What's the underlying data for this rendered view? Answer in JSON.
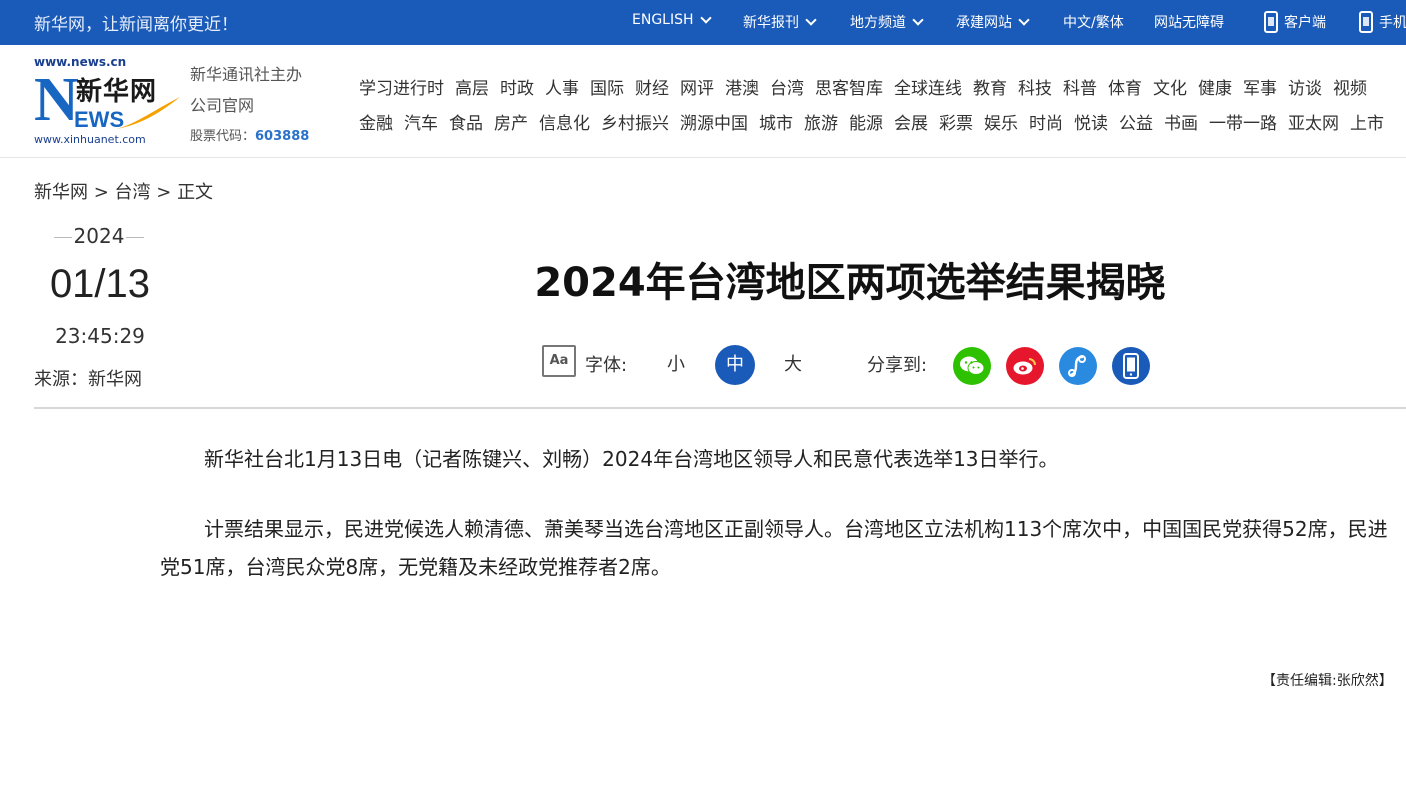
{
  "topbar": {
    "slogan": "新华网，让新闻离你更近！",
    "items": {
      "english": "ENGLISH",
      "newspapers": "新华报刊",
      "local": "地方频道",
      "hosted": "承建网站",
      "lang": "中文/繁体",
      "accessible": "网站无障碍",
      "client": "客户端",
      "mobile": "手机"
    }
  },
  "logo": {
    "url_top": "www.news.cn",
    "brand_cn": "新华网",
    "brand_en": "EWS",
    "letter_n": "N",
    "url_bottom": "www.xinhuanet.com"
  },
  "sponsor": {
    "line1": "新华通讯社主办",
    "line2": "公司官网",
    "stock_label": "股票代码：",
    "stock_code": "603888"
  },
  "nav": {
    "row1": [
      "学习进行时",
      "高层",
      "时政",
      "人事",
      "国际",
      "财经",
      "网评",
      "港澳",
      "台湾",
      "思客智库",
      "全球连线",
      "教育",
      "科技",
      "科普",
      "体育",
      "文化",
      "健康",
      "军事",
      "访谈",
      "视频"
    ],
    "row2": [
      "金融",
      "汽车",
      "食品",
      "房产",
      "信息化",
      "乡村振兴",
      "溯源中国",
      "城市",
      "旅游",
      "能源",
      "会展",
      "彩票",
      "娱乐",
      "时尚",
      "悦读",
      "公益",
      "书画",
      "一带一路",
      "亚太网",
      "上市"
    ]
  },
  "breadcrumb": {
    "home": "新华网",
    "sep1": " > ",
    "section": "台湾",
    "sep2": " > ",
    "current": "正文"
  },
  "article": {
    "year": "2024",
    "month_day": "01/13",
    "time": "23:45:29",
    "source": "来源：新华网",
    "title": "2024年台湾地区两项选举结果揭晓",
    "paragraphs": [
      "新华社台北1月13日电（记者陈键兴、刘畅）2024年台湾地区领导人和民意代表选举13日举行。",
      "计票结果显示，民进党候选人赖清德、萧美琴当选台湾地区正副领导人。台湾地区立法机构113个席次中，中国国民党获得52席，民进党51席，台湾民众党8席，无党籍及未经政党推荐者2席。"
    ],
    "editor": "【责任编辑:张欣然】"
  },
  "toolbar": {
    "font_icon_text": "Aa",
    "font_label": "字体:",
    "small": "小",
    "medium": "中",
    "large": "大",
    "share_label": "分享到:",
    "share_icons": [
      "wechat-icon",
      "weibo-icon",
      "link-icon",
      "mobile-icon"
    ],
    "colors": {
      "wechat": "#2dc100",
      "weibo": "#e6162d",
      "link": "#2a8ae0",
      "mobile": "#1a5ab8",
      "accent": "#1a5ab8"
    }
  }
}
